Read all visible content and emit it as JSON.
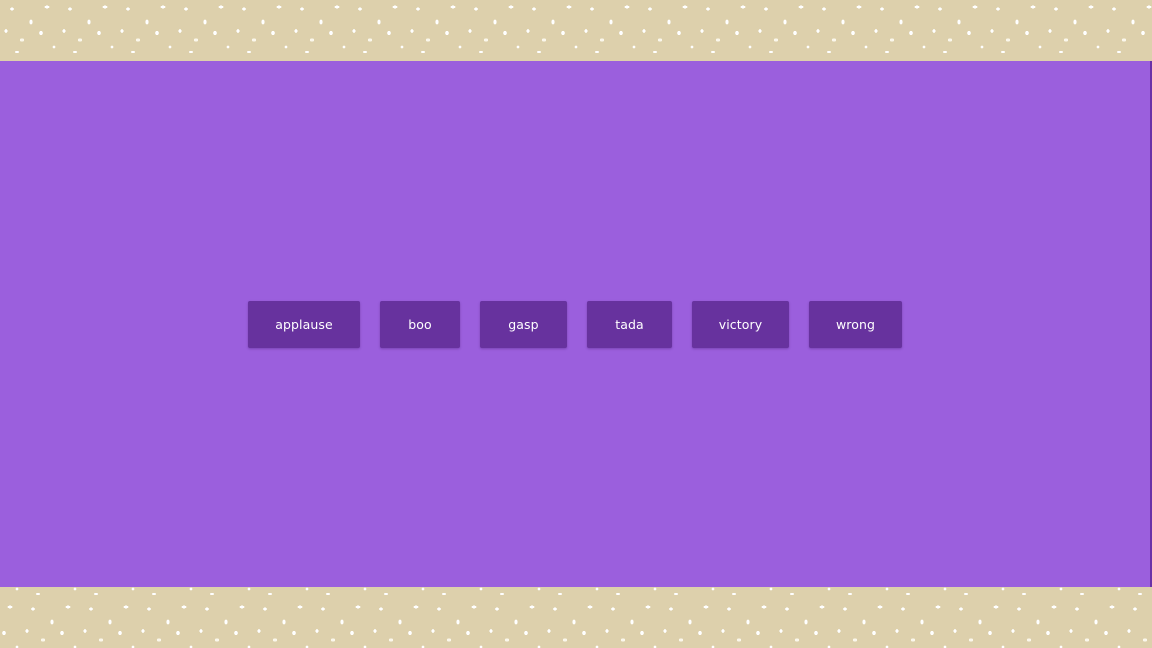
{
  "colors": {
    "stage_background": "#9b5fdd",
    "button_background": "#67329e",
    "button_text": "#ffffff",
    "border_background": "#ddd0ac",
    "confetti": "#ffffff"
  },
  "sound_buttons": [
    {
      "label": "applause"
    },
    {
      "label": "boo"
    },
    {
      "label": "gasp"
    },
    {
      "label": "tada"
    },
    {
      "label": "victory"
    },
    {
      "label": "wrong"
    }
  ]
}
